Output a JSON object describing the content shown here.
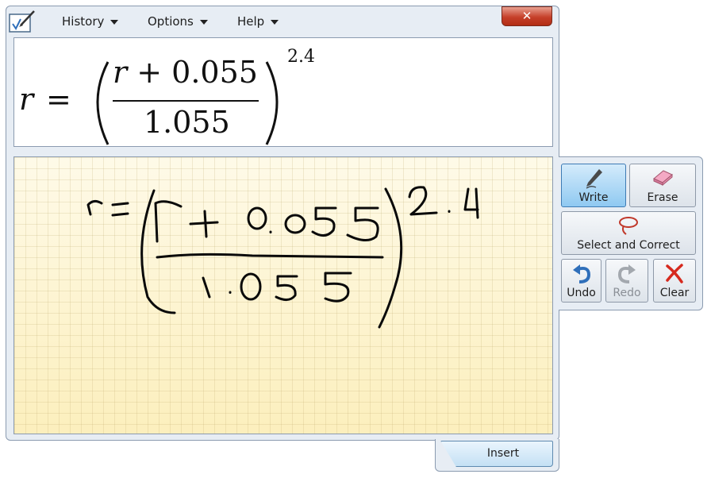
{
  "menu": {
    "history": "History",
    "options": "Options",
    "help": "Help"
  },
  "window": {
    "close_glyph": "✕"
  },
  "preview": {
    "lhs": "r",
    "equals": "=",
    "numerator_var": "r",
    "numerator_rest": " + 0.055",
    "denominator": "1.055",
    "exponent": "2.4"
  },
  "tools": {
    "write": "Write",
    "erase": "Erase",
    "select_correct": "Select and Correct",
    "undo": "Undo",
    "redo": "Redo",
    "clear": "Clear"
  },
  "actions": {
    "insert": "Insert"
  },
  "colors": {
    "active_tool": "#8fc9f1",
    "undo_icon": "#2f6fba",
    "clear_icon": "#d62a1e",
    "lasso_icon": "#c0392b"
  }
}
